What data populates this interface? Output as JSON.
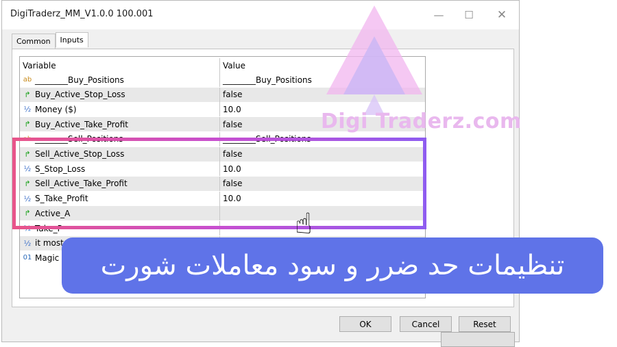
{
  "window": {
    "title": "DigiTraderz_MM_V1.0.0 100.001"
  },
  "tabs": [
    {
      "label": "Common"
    },
    {
      "label": "Inputs"
    }
  ],
  "table": {
    "header": {
      "variable": "Variable",
      "value": "Value"
    },
    "rows": [
      {
        "icon": "ab",
        "variable": "________Buy_Positions",
        "value": "________Buy_Positions"
      },
      {
        "icon": "arrow",
        "variable": "Buy_Active_Stop_Loss",
        "value": "false"
      },
      {
        "icon": "half",
        "variable": "Money ($)",
        "value": "10.0"
      },
      {
        "icon": "arrow",
        "variable": "Buy_Active_Take_Profit",
        "value": "false"
      },
      {
        "icon": "ab",
        "variable": "________Sell_Positions",
        "value": "________Sell_Positions"
      },
      {
        "icon": "arrow",
        "variable": "Sell_Active_Stop_Loss",
        "value": "false"
      },
      {
        "icon": "half",
        "variable": "S_Stop_Loss",
        "value": "10.0"
      },
      {
        "icon": "arrow",
        "variable": "Sell_Active_Take_Profit",
        "value": "false"
      },
      {
        "icon": "half",
        "variable": "S_Take_Profit",
        "value": "10.0"
      },
      {
        "icon": "arrow",
        "variable": "Active_A",
        "value": ""
      },
      {
        "icon": "half",
        "variable": "Take_P",
        "value": ""
      },
      {
        "icon": "half",
        "variable": "it most",
        "value": ""
      },
      {
        "icon": "01",
        "variable": "Magic Nu",
        "value": ""
      }
    ]
  },
  "buttons": {
    "ok": "OK",
    "cancel": "Cancel",
    "reset": "Reset"
  },
  "watermark": {
    "text": "Digi  Traderz.com"
  },
  "banner": {
    "text": "تنظیمات حد ضرر و سود معاملات شورت"
  },
  "colors": {
    "highlight_start": "#e8548a",
    "highlight_end": "#8f5cf0",
    "banner_bg": "#5f73e8"
  }
}
